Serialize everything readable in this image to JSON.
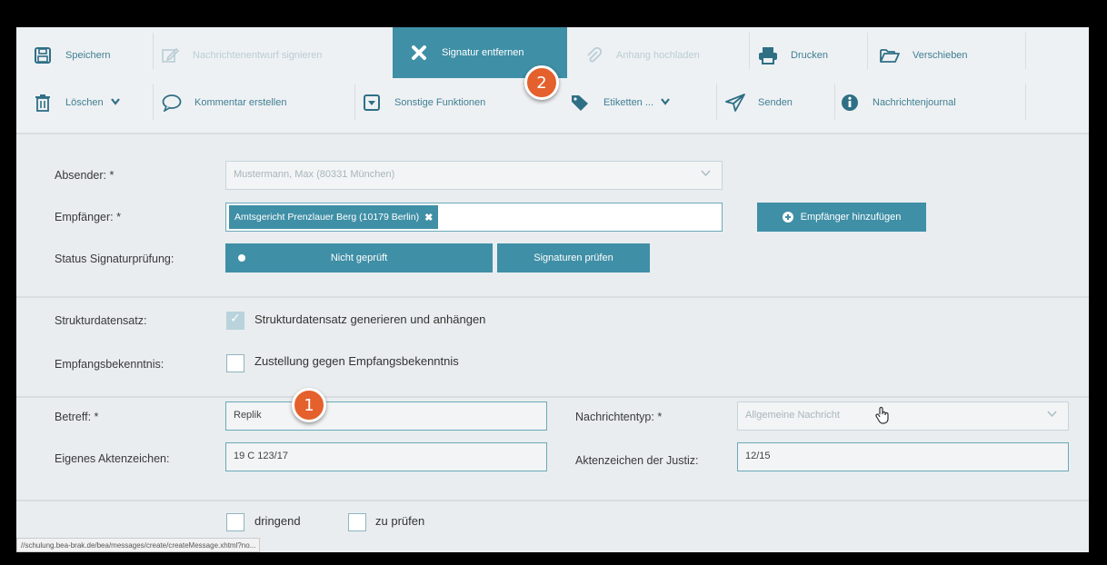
{
  "toolbar": {
    "row1": [
      {
        "label": "Speichern",
        "icon": "save-icon",
        "state": "normal"
      },
      {
        "label": "Nachrichtenentwurf signieren",
        "icon": "edit-icon",
        "state": "disabled"
      },
      {
        "label": "Signatur entfernen",
        "icon": "close-icon",
        "state": "active"
      },
      {
        "label": "Anhang hochladen",
        "icon": "paperclip-icon",
        "state": "disabled"
      },
      {
        "label": "Drucken",
        "icon": "printer-icon",
        "state": "normal"
      },
      {
        "label": "Verschieben",
        "icon": "folder-icon",
        "state": "normal"
      }
    ],
    "row2": [
      {
        "label": "Löschen",
        "icon": "trash-icon",
        "state": "normal",
        "dropdown": true
      },
      {
        "label": "Kommentar erstellen",
        "icon": "comment-icon",
        "state": "normal"
      },
      {
        "label": "Sonstige Funktionen",
        "icon": "dropdown-box-icon",
        "state": "normal"
      },
      {
        "label": "Etiketten ...",
        "icon": "tag-icon",
        "state": "normal",
        "dropdown": true
      },
      {
        "label": "Senden",
        "icon": "send-icon",
        "state": "normal"
      },
      {
        "label": "Nachrichtenjournal",
        "icon": "info-icon",
        "state": "normal"
      }
    ]
  },
  "form": {
    "absender_label": "Absender: *",
    "absender_value": "Mustermann, Max (80331 München)",
    "empfaenger_label": "Empfänger: *",
    "empfaenger_tag": "Amtsgericht Prenzlauer Berg (10179 Berlin)",
    "empfaenger_add_button": "Empfänger hinzufügen",
    "status_label": "Status Signaturprüfung:",
    "status_value": "Nicht geprüft",
    "signaturen_button": "Signaturen prüfen",
    "struktur_label": "Strukturdatensatz:",
    "struktur_checkbox": "Strukturdatensatz generieren und anhängen",
    "empfangs_label": "Empfangsbekenntnis:",
    "empfangs_checkbox": "Zustellung gegen Empfangsbekenntnis",
    "betreff_label": "Betreff: *",
    "betreff_value": "Replik",
    "nachrichtentyp_label": "Nachrichtentyp: *",
    "nachrichtentyp_value": "Allgemeine Nachricht",
    "aktenzeichen_label": "Eigenes Aktenzeichen:",
    "aktenzeichen_value": "19 C 123/17",
    "justiz_label": "Aktenzeichen der Justiz:",
    "justiz_value": "12/15",
    "dringend_label": "dringend",
    "pruefen_label": "zu prüfen"
  },
  "badges": {
    "one": "1",
    "two": "2"
  },
  "statusbar_url": "//schulung.bea-brak.de/bea/messages/create/createMessage.xhtml?no...",
  "colors": {
    "accent": "#3f8fa6",
    "badge": "#e4602c",
    "background": "#e9edef"
  }
}
